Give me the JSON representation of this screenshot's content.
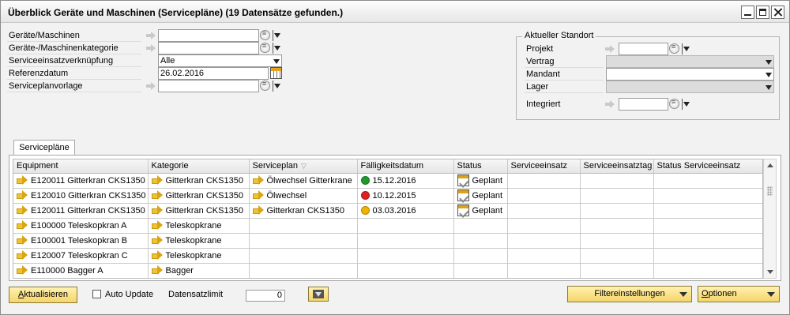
{
  "window": {
    "title": "Überblick Geräte und Maschinen (Servicepläne) (19 Datensätze gefunden.)"
  },
  "filters": {
    "geraete_label": "Geräte/Maschinen",
    "geraete_value": "",
    "kategorie_label": "Geräte-/Maschinenkategorie",
    "kategorie_value": "",
    "verknuepfung_label": "Serviceeinsatzverknüpfung",
    "verknuepfung_value": "Alle",
    "referenzdatum_label": "Referenzdatum",
    "referenzdatum_value": "26.02.2016",
    "vorlage_label": "Serviceplanvorlage",
    "vorlage_value": ""
  },
  "standort": {
    "legend": "Aktueller Standort",
    "projekt_label": "Projekt",
    "projekt_value": "",
    "vertrag_label": "Vertrag",
    "mandant_label": "Mandant",
    "mandant_value": "",
    "lager_label": "Lager",
    "integriert_label": "Integriert",
    "integriert_value": ""
  },
  "tabs": {
    "active": "Servicepläne"
  },
  "grid": {
    "columns": [
      "Equipment",
      "Kategorie",
      "Serviceplan",
      "Fälligkeitsdatum",
      "Status",
      "Serviceeinsatz",
      "Serviceeinsatztag",
      "Status Serviceeinsatz"
    ],
    "rows": [
      {
        "equipment": "E120011 Gitterkran CKS1350",
        "kategorie": "Gitterkran CKS1350",
        "serviceplan": "Ölwechsel Gitterkrane",
        "faelligkeit": "15.12.2016",
        "faelligkeit_color": "#1f9a2e",
        "status": "Geplant",
        "serviceeinsatz": "",
        "serviceeinsatztag": "",
        "status_serviceeinsatz": ""
      },
      {
        "equipment": "E120010 Gitterkran CKS1350",
        "kategorie": "Gitterkran CKS1350",
        "serviceplan": "Ölwechsel",
        "faelligkeit": "10.12.2015",
        "faelligkeit_color": "#e02020",
        "status": "Geplant",
        "serviceeinsatz": "",
        "serviceeinsatztag": "",
        "status_serviceeinsatz": ""
      },
      {
        "equipment": "E120011 Gitterkran CKS1350",
        "kategorie": "Gitterkran CKS1350",
        "serviceplan": "Gitterkran CKS1350",
        "faelligkeit": "03.03.2016",
        "faelligkeit_color": "#f0b400",
        "status": "Geplant",
        "serviceeinsatz": "",
        "serviceeinsatztag": "",
        "status_serviceeinsatz": ""
      },
      {
        "equipment": "E100000 Teleskopkran A",
        "kategorie": "Teleskopkrane",
        "serviceplan": "",
        "faelligkeit": "",
        "faelligkeit_color": "",
        "status": "",
        "serviceeinsatz": "",
        "serviceeinsatztag": "",
        "status_serviceeinsatz": ""
      },
      {
        "equipment": "E100001 Teleskopkran B",
        "kategorie": "Teleskopkrane",
        "serviceplan": "",
        "faelligkeit": "",
        "faelligkeit_color": "",
        "status": "",
        "serviceeinsatz": "",
        "serviceeinsatztag": "",
        "status_serviceeinsatz": ""
      },
      {
        "equipment": "E120007 Teleskopkran C",
        "kategorie": "Teleskopkrane",
        "serviceplan": "",
        "faelligkeit": "",
        "faelligkeit_color": "",
        "status": "",
        "serviceeinsatz": "",
        "serviceeinsatztag": "",
        "status_serviceeinsatz": ""
      },
      {
        "equipment": "E110000 Bagger A",
        "kategorie": "Bagger",
        "serviceplan": "",
        "faelligkeit": "",
        "faelligkeit_color": "",
        "status": "",
        "serviceeinsatz": "",
        "serviceeinsatztag": "",
        "status_serviceeinsatz": ""
      }
    ]
  },
  "footer": {
    "aktualisieren_acc": "A",
    "aktualisieren_rest": "ktualisieren",
    "auto_update_label": "Auto Update",
    "datensatzlimit_label": "Datensatzlimit",
    "datensatzlimit_value": "0",
    "filtereinstellungen_label": "Filtereinstellungen",
    "optionen_acc": "O",
    "optionen_rest": "ptionen"
  }
}
